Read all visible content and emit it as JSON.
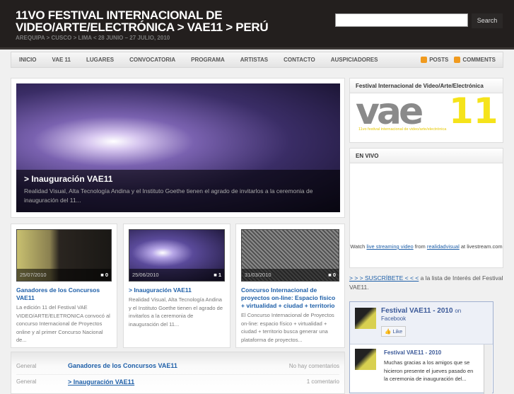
{
  "header": {
    "title_line1": "11VO FESTIVAL INTERNACIONAL DE",
    "title_line2": "VIDEO/ARTE/ELECTRÓNICA > VAE11 > PERÚ",
    "tagline": "AREQUIPA > CUSCO > LIMA < 28 JUNIO – 27 JULIO, 2010",
    "search_placeholder": "",
    "search_label": "Search"
  },
  "nav": {
    "items": [
      "INICIO",
      "VAE 11",
      "LUGARES",
      "CONVOCATORIA",
      "PROGRAMA",
      "ARTISTAS",
      "CONTACTO",
      "AUSPICIADORES"
    ],
    "posts": "POSTS",
    "comments": "COMMENTS"
  },
  "featured": {
    "title": "> Inauguración VAE11",
    "excerpt": "Realidad Visual, Alta Tecnología Andina y el Instituto Goethe tienen el agrado de invitarlos a la ceremonia de inauguración del 11..."
  },
  "cards": [
    {
      "date": "25/07/2010",
      "comments": "0",
      "title": "Ganadores de los Concursos VAE11",
      "excerpt": "La edición 11 del Festival VAE VIDEO/ARTE/ELETRONICA convocó al concurso Internacional de Proyectos online y al primer Concurso Nacional de..."
    },
    {
      "date": "25/06/2010",
      "comments": "1",
      "title": "> Inauguración VAE11",
      "excerpt": "Realidad Visual, Alta Tecnología Andina y el Instituto Goethe tienen el agrado de invitarlos a la ceremonia de inauguración del 11..."
    },
    {
      "date": "31/03/2010",
      "comments": "0",
      "title": "Concurso Internacional de proyectos on-line: Espacio físico + virtualidad + ciudad + territorio",
      "excerpt": "El Concurso Internacional de Proyectos on-line: espacio físico + virtualidad + ciudad + territorio busca generar una plataforma de proyectos..."
    }
  ],
  "list": [
    {
      "category": "General",
      "title": "Ganadores de los Concursos VAE11",
      "comments": "No hay comentarios"
    },
    {
      "category": "General",
      "title": "> Inauguración VAE11",
      "comments": "1 comentario"
    }
  ],
  "sidebar": {
    "logo_widget_title": "Festival Internacional de Video/Arte/Electrónica",
    "logo_text": "vae",
    "logo_number": "11",
    "logo_sub": "11vo festival internacional de video/arte/electrónica",
    "live_title": "EN VIVO",
    "live_watch": "Watch",
    "live_link1": "live streaming video",
    "live_from": "from",
    "live_link2": "realidadvisual",
    "live_at": "at livestream.com",
    "subscribe_link": "> > > SUSCRÍBETE < < <",
    "subscribe_text": " a la lista de Interés del Festival VAE11.",
    "fb_name": "Festival VAE11 - 2010",
    "fb_on": "on",
    "fb_facebook": "Facebook",
    "fb_like": "Like",
    "fb_post_title": "Festival VAE11 - 2010",
    "fb_post_text": "Muchas gracias a los amigos que se hicieron presente el jueves pasado en la ceremonia de inauguración del..."
  },
  "colors": {
    "header_bg": "#231f1e",
    "link": "#1e5fa8",
    "facebook": "#3b5998",
    "logo_yellow": "#f5e31a"
  }
}
